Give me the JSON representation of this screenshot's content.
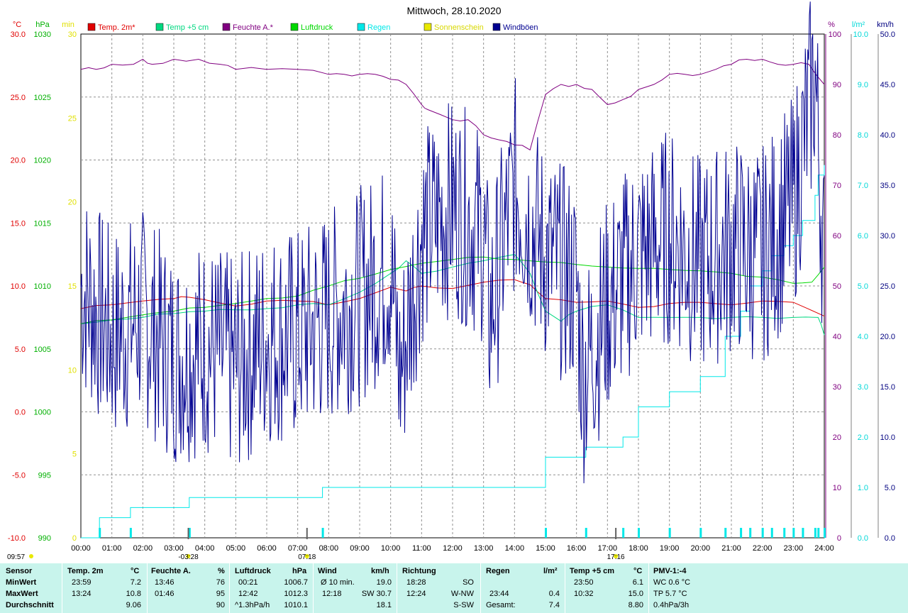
{
  "chart_data": {
    "type": "line",
    "title": "Mittwoch, 28.10.2020",
    "x_ticks": [
      "00:00",
      "01:00",
      "02:00",
      "03:00",
      "04:00",
      "05:00",
      "06:00",
      "07:00",
      "08:00",
      "09:00",
      "10:00",
      "11:00",
      "12:00",
      "13:00",
      "14:00",
      "15:00",
      "16:00",
      "17:00",
      "18:00",
      "19:00",
      "20:00",
      "21:00",
      "22:00",
      "23:00",
      "24:00"
    ],
    "axes": {
      "temp": {
        "unit": "°C",
        "ticks": [
          "30.0",
          "25.0",
          "20.0",
          "15.0",
          "10.0",
          "5.0",
          "0.0",
          "-5.0",
          "-10.0"
        ],
        "range": [
          -10,
          30
        ],
        "color": "#e00000"
      },
      "pressure": {
        "unit": "hPa",
        "ticks": [
          "1030",
          "1025",
          "1020",
          "1015",
          "1010",
          "1005",
          "1000",
          "995",
          "990"
        ],
        "range": [
          990,
          1030
        ],
        "color": "#00b000"
      },
      "sunshine": {
        "unit": "min",
        "ticks": [
          "30",
          "25",
          "20",
          "15",
          "10",
          "5",
          "0"
        ],
        "range": [
          0,
          30
        ],
        "color": "#e0e000"
      },
      "humidity": {
        "unit": "%",
        "ticks": [
          "100",
          "90",
          "80",
          "70",
          "60",
          "50",
          "40",
          "30",
          "20",
          "10",
          "0"
        ],
        "range": [
          0,
          100
        ],
        "color": "#800080"
      },
      "rain": {
        "unit": "l/m²",
        "ticks": [
          "10.0",
          "9.0",
          "8.0",
          "7.0",
          "6.0",
          "5.0",
          "4.0",
          "3.0",
          "2.0",
          "1.0",
          "0.0"
        ],
        "range": [
          0,
          10
        ],
        "color": "#00d8d8"
      },
      "wind": {
        "unit": "km/h",
        "ticks": [
          "50.0",
          "45.0",
          "40.0",
          "35.0",
          "30.0",
          "25.0",
          "20.0",
          "15.0",
          "10.0",
          "5.0",
          "0.0"
        ],
        "range": [
          0,
          50
        ],
        "color": "#000080"
      }
    },
    "legend": [
      {
        "name": "Temp. 2m*",
        "color": "#e00000"
      },
      {
        "name": "Temp +5 cm",
        "color": "#00d880"
      },
      {
        "name": "Feuchte A.*",
        "color": "#800080"
      },
      {
        "name": "Luftdruck",
        "color": "#00d800"
      },
      {
        "name": "Regen",
        "color": "#00e8e8"
      },
      {
        "name": "Sonnenschein",
        "color": "#e8e800"
      },
      {
        "name": "Windböen",
        "color": "#000090"
      }
    ],
    "series": [
      {
        "name": "Temp. 2m*",
        "axis": "temp",
        "color": "#e00000",
        "x": [
          0,
          1,
          2,
          3,
          3.5,
          4,
          5,
          6,
          7,
          8,
          9,
          10,
          10.5,
          11,
          12,
          13,
          14,
          14.5,
          15,
          16,
          17,
          18,
          19,
          20,
          21,
          22,
          23,
          24
        ],
        "values": [
          8.2,
          8.5,
          8.8,
          9.0,
          9.1,
          8.9,
          8.4,
          8.8,
          8.8,
          8.5,
          9.0,
          9.9,
          9.6,
          10.0,
          9.8,
          10.3,
          10.5,
          10.1,
          9.0,
          8.7,
          8.8,
          8.3,
          8.6,
          8.7,
          8.5,
          8.8,
          8.7,
          7.6
        ]
      },
      {
        "name": "Temp +5 cm",
        "axis": "temp",
        "color": "#00d880",
        "x": [
          0,
          1,
          2,
          3,
          4,
          5,
          6,
          7,
          8,
          9,
          10,
          10.5,
          11,
          12,
          13,
          14,
          14.5,
          15,
          15.5,
          16,
          17,
          18,
          19,
          20,
          21,
          22,
          23,
          23.8,
          24
        ],
        "values": [
          7.0,
          7.3,
          7.5,
          7.8,
          8.0,
          8.1,
          8.2,
          8.5,
          8.5,
          9.5,
          11.0,
          12.0,
          11.0,
          11.5,
          12.0,
          12.5,
          11.0,
          8.0,
          7.2,
          8.0,
          8.5,
          7.5,
          7.5,
          7.5,
          7.5,
          7.5,
          7.5,
          7.5,
          6.1
        ]
      },
      {
        "name": "Feuchte A.*",
        "axis": "humidity",
        "color": "#800080",
        "x": [
          0,
          0.5,
          1,
          1.7,
          2,
          2.3,
          3,
          3.8,
          4.5,
          5,
          6,
          7,
          8,
          8.5,
          9,
          9.5,
          10,
          10.5,
          11,
          11.2,
          12,
          12.5,
          13,
          13.5,
          14,
          14.5,
          15,
          15.5,
          16,
          16.5,
          17,
          17.5,
          18,
          18.5,
          19,
          19.5,
          20,
          20.5,
          21,
          21.5,
          22,
          22.5,
          23,
          23.5,
          24
        ],
        "values": [
          93,
          93,
          94,
          94,
          95,
          94,
          95,
          95,
          94,
          93,
          93,
          93,
          92,
          92,
          92,
          92,
          91,
          90,
          86,
          85,
          83,
          83,
          80,
          79,
          78,
          77,
          88,
          90,
          90,
          89,
          86,
          87,
          89,
          90,
          92,
          92,
          92,
          93,
          94,
          95,
          95,
          94,
          94,
          94,
          90
        ]
      },
      {
        "name": "Luftdruck",
        "axis": "pressure",
        "color": "#00d800",
        "x": [
          0,
          1,
          2,
          3,
          4,
          5,
          6,
          7,
          8,
          9,
          10,
          11,
          12,
          13,
          14,
          15,
          16,
          17,
          18,
          19,
          20,
          21,
          22,
          23,
          23.6,
          24
        ],
        "values": [
          1007.0,
          1007.3,
          1007.7,
          1008.0,
          1008.3,
          1008.6,
          1009.0,
          1009.2,
          1010.0,
          1010.6,
          1011.3,
          1011.8,
          1012.1,
          1012.3,
          1012.1,
          1011.9,
          1011.7,
          1011.5,
          1011.4,
          1011.3,
          1011.2,
          1011.0,
          1010.7,
          1010.2,
          1010.3,
          1011.5
        ]
      },
      {
        "name": "Regen",
        "axis": "rain",
        "color": "#00e8e8",
        "step": true,
        "x": [
          0,
          0.6,
          1.6,
          3.5,
          7.8,
          15.0,
          16.3,
          17.5,
          18.0,
          19.0,
          20.0,
          20.8,
          21.3,
          21.6,
          22.0,
          22.3,
          22.7,
          23.0,
          23.3,
          23.7,
          23.8,
          24
        ],
        "values": [
          0,
          0.4,
          0.6,
          0.8,
          1.0,
          1.6,
          1.8,
          2.0,
          2.6,
          2.9,
          3.2,
          4.0,
          4.5,
          5.0,
          5.3,
          5.6,
          5.8,
          6.0,
          6.3,
          6.8,
          7.2,
          7.4
        ]
      },
      {
        "name": "Windböen",
        "axis": "wind",
        "color": "#000090",
        "noisy": true,
        "x": [
          0,
          1,
          2,
          3,
          4,
          5,
          6,
          7,
          8,
          9,
          10,
          10.3,
          11,
          12,
          13,
          13.2,
          14,
          15,
          16,
          16.2,
          17,
          18,
          19,
          20,
          21,
          22,
          23,
          23.7,
          24
        ],
        "values": [
          25,
          20,
          22,
          18,
          19,
          17,
          20,
          20,
          22,
          24,
          27,
          16,
          30,
          33,
          30,
          22,
          35,
          28,
          25,
          16,
          23,
          28,
          30,
          27,
          29,
          28,
          33,
          46,
          27
        ]
      }
    ],
    "sun_markers": [
      {
        "time": "-03:28",
        "x": 3.47
      },
      {
        "time": "07:18",
        "x": 7.3
      },
      {
        "time": "17:16",
        "x": 17.27
      }
    ],
    "corner_time": "09:57"
  },
  "stats": {
    "sensor": {
      "header": "Sensor",
      "rows": [
        "MinWert",
        "MaxWert",
        "Durchschnitt"
      ]
    },
    "temp2m": {
      "header": "Temp. 2m",
      "unit": "°C",
      "times": [
        "23:59",
        "13:24",
        ""
      ],
      "values": [
        "7.2",
        "10.8",
        "9.06"
      ]
    },
    "humidity": {
      "header": "Feuchte A.",
      "unit": "%",
      "times": [
        "13:46",
        "01:46",
        ""
      ],
      "values": [
        "76",
        "95",
        "90"
      ]
    },
    "pressure": {
      "header": "Luftdruck",
      "unit": "hPa",
      "times": [
        "00:21",
        "12:42",
        "^1.3hPa/h"
      ],
      "values": [
        "1006.7",
        "1012.3",
        "1010.1"
      ]
    },
    "wind": {
      "header": "Wind",
      "unit": "km/h",
      "times": [
        "Ø 10 min.",
        "12:18",
        ""
      ],
      "values": [
        "19.0",
        "SW 30.7",
        "18.1"
      ]
    },
    "direction": {
      "header": "Richtung",
      "times": [
        "18:28",
        "12:24",
        ""
      ],
      "values": [
        "SO",
        "W-NW",
        "S-SW"
      ]
    },
    "rain": {
      "header": "Regen",
      "unit": "l/m²",
      "times": [
        "",
        "23:44",
        "Gesamt:"
      ],
      "values": [
        "",
        "0.4",
        "7.4"
      ]
    },
    "temp5": {
      "header": "Temp +5 cm",
      "unit": "°C",
      "times": [
        "23:50",
        "10:32",
        ""
      ],
      "values": [
        "6.1",
        "15.0",
        "8.80"
      ]
    },
    "pmv": {
      "header": "PMV-1:-4",
      "rows": [
        "WC 0.6 °C",
        "TP 5.7 °C",
        "0.4hPa/3h"
      ]
    }
  }
}
